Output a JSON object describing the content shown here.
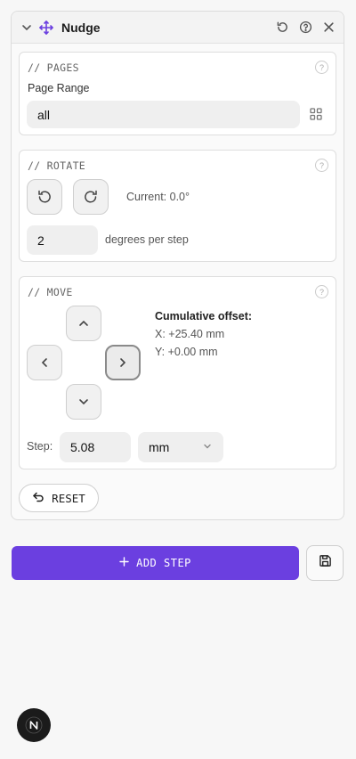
{
  "panel": {
    "title": "Nudge",
    "icons": {
      "collapse": "chevron-down-icon",
      "move": "move-icon",
      "reset": "rotate-ccw-icon",
      "help": "help-circle-icon",
      "close": "close-icon"
    }
  },
  "pages": {
    "section_title": "// PAGES",
    "range_label": "Page Range",
    "range_value": "all",
    "grid_icon": "grid-icon"
  },
  "rotate": {
    "section_title": "// ROTATE",
    "current_text": "Current: 0.0°",
    "degrees_value": "2",
    "degrees_suffix": "degrees per step"
  },
  "move": {
    "section_title": "// MOVE",
    "offset_heading": "Cumulative offset:",
    "offset_x": "X: +25.40 mm",
    "offset_y": "Y: +0.00 mm",
    "step_label": "Step:",
    "step_value": "5.08",
    "unit_selected": "mm"
  },
  "reset_label": "RESET",
  "add_step_label": "ADD STEP",
  "colors": {
    "accent": "#6b3fe0",
    "badge": "#1b1b1b"
  }
}
